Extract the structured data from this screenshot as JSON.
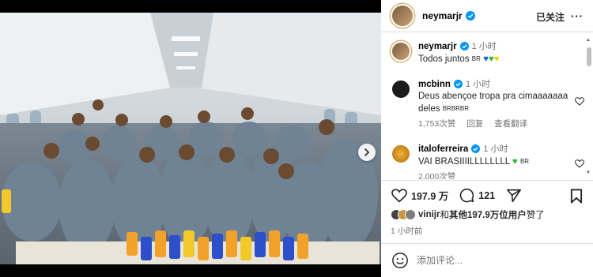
{
  "post": {
    "author": "neymarjr",
    "follow_status": "已关注",
    "more_icon": "more-dots-icon"
  },
  "caption": {
    "username": "neymarjr",
    "time": "1 小时",
    "text": "Todos juntos",
    "flag": "BR",
    "heart_colors": [
      "#1a5fd6",
      "#2fb52f",
      "#f5d10a"
    ]
  },
  "comments": [
    {
      "username": "mcbinn",
      "time": "1 小时",
      "text": "Deus abençoe tropa pra cimaaaaaaa deles",
      "flags": "BRBRBR",
      "likes": "1,753次赞",
      "reply": "回复",
      "translate": "查看翻译"
    },
    {
      "username": "italoferreira",
      "time": "1 小时",
      "text": "VAI BRASIIIILLLLLLLL",
      "flag": "BR",
      "heart_color": "#2fb52f",
      "likes": "2,000次赞"
    }
  ],
  "actions": {
    "like_count": "197.9 万",
    "comment_count": "121"
  },
  "likes_summary": {
    "liker": "vinijr",
    "connector": "和",
    "others": "其他197.9万位用户",
    "suffix": "赞了"
  },
  "post_time": "1 小时前",
  "comment_input": {
    "placeholder": "添加评论..."
  },
  "colors": {
    "verified": "#0095f6",
    "ring": "#d6b36a",
    "jersey": "#6f8395"
  }
}
